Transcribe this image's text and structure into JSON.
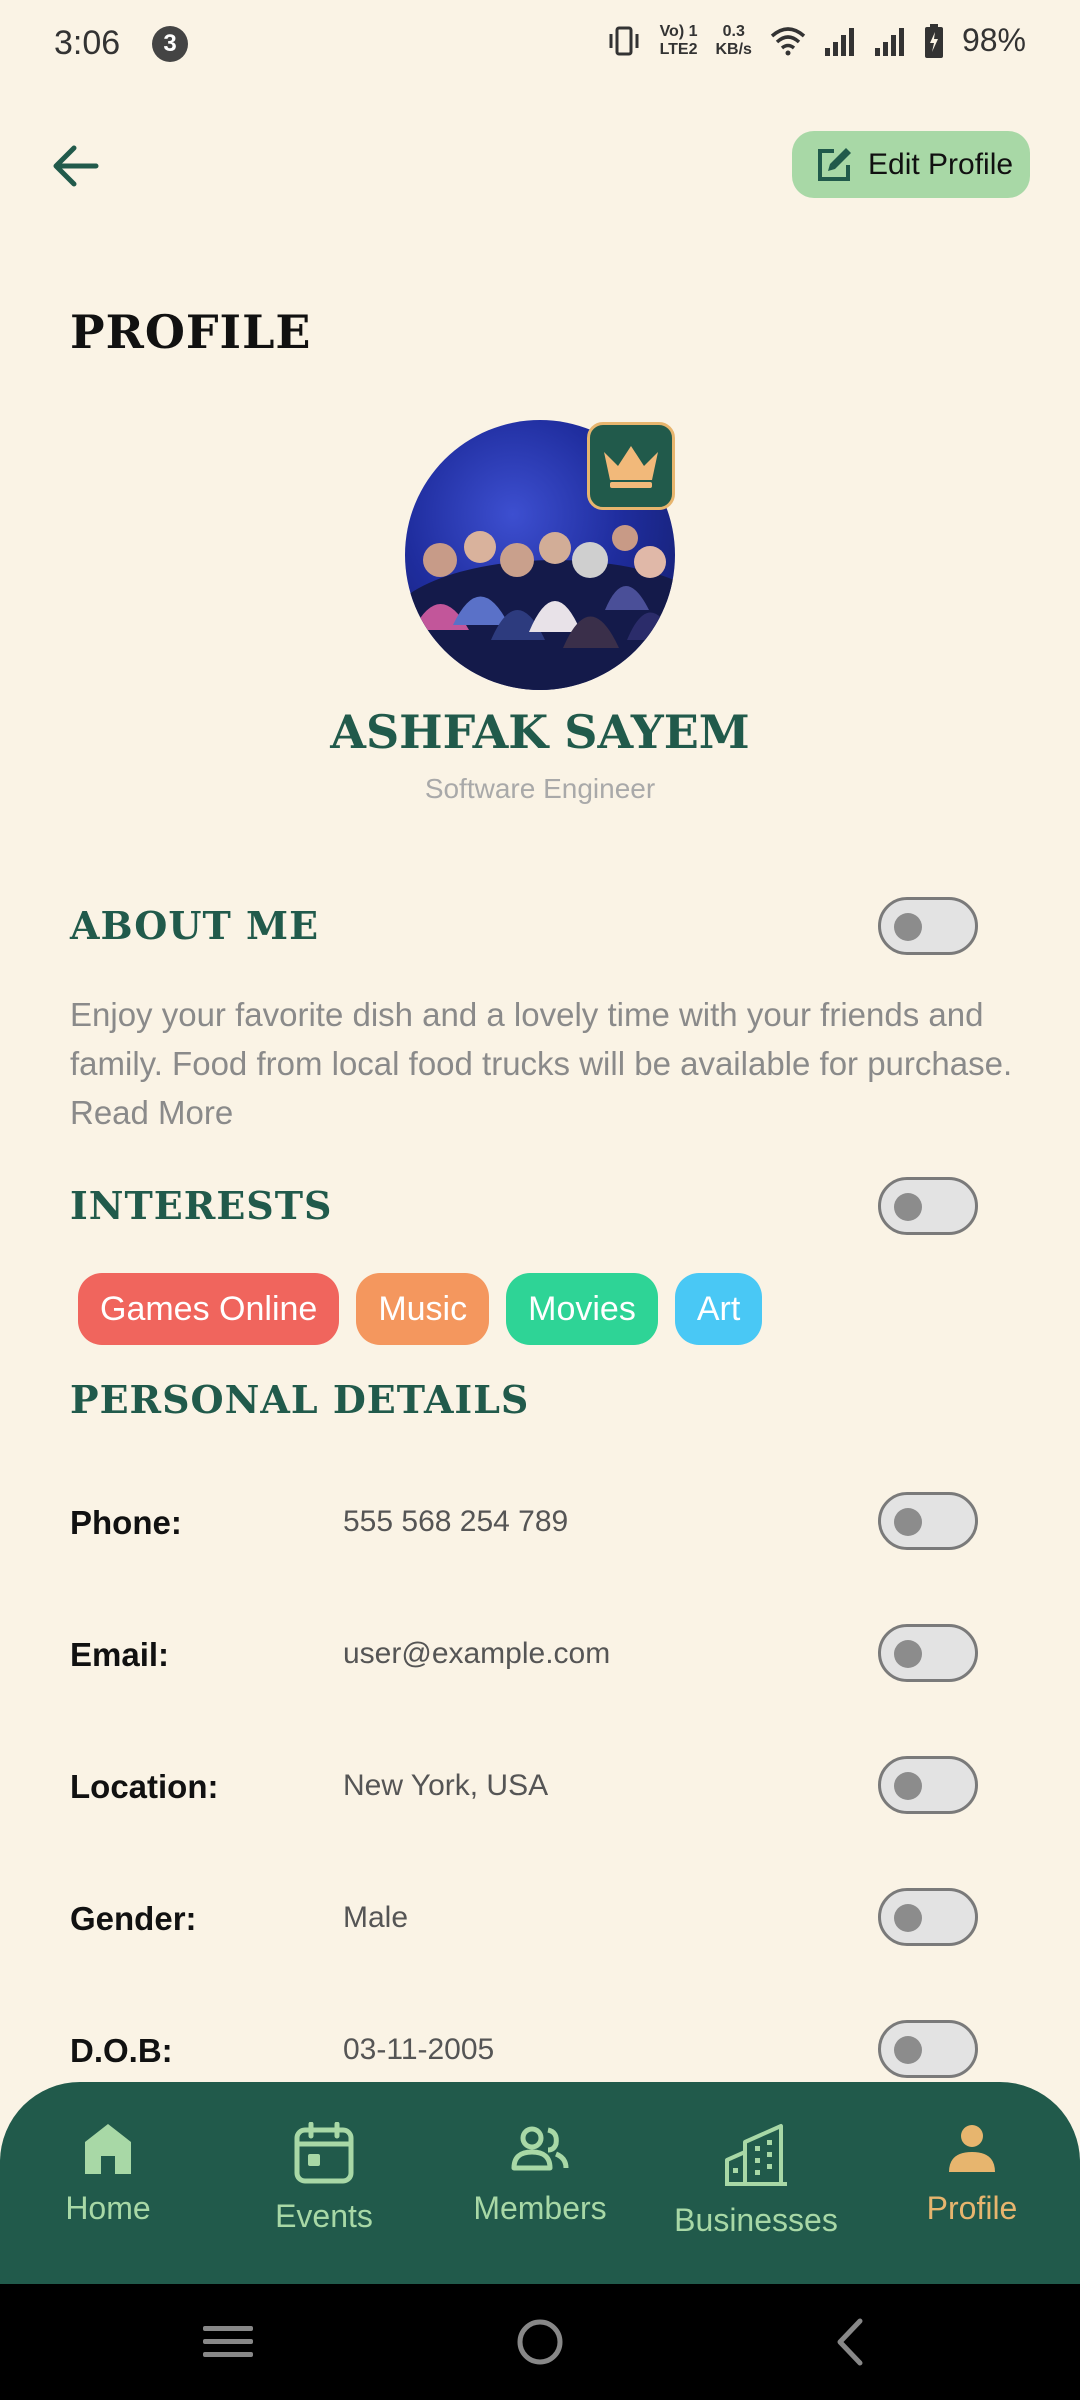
{
  "status_bar": {
    "time": "3:06",
    "notification_count": "3",
    "network_line1": "Vo) 1",
    "network_line2": "LTE2",
    "speed_line1": "0.3",
    "speed_line2": "KB/s",
    "battery": "98%"
  },
  "header": {
    "edit_label": "Edit Profile"
  },
  "page_title": "PROFILE",
  "user": {
    "name": "ASHFAK SAYEM",
    "role": "Software Engineer"
  },
  "about": {
    "heading": "ABOUT ME",
    "text": "Enjoy your favorite dish and a lovely time with your friends and family. Food from local food trucks will be available for purchase. Read More",
    "visible": false
  },
  "interests": {
    "heading": "INTERESTS",
    "visible": false,
    "items": [
      {
        "label": "Games Online",
        "color": "#f0655d"
      },
      {
        "label": "Music",
        "color": "#f4975e"
      },
      {
        "label": "Movies",
        "color": "#2ed496"
      },
      {
        "label": "Art",
        "color": "#49c8f5"
      }
    ]
  },
  "personal": {
    "heading": "PERSONAL DETAILS",
    "rows": [
      {
        "label": "Phone:",
        "value": "555 568 254 789",
        "visible": false
      },
      {
        "label": "Email:",
        "value": "user@example.com",
        "visible": false
      },
      {
        "label": "Location:",
        "value": "New York, USA",
        "visible": false
      },
      {
        "label": "Gender:",
        "value": "Male",
        "visible": false
      },
      {
        "label": "D.O.B:",
        "value": "03-11-2005",
        "visible": false
      }
    ]
  },
  "nav": {
    "items": [
      {
        "label": "Home",
        "icon": "home-icon"
      },
      {
        "label": "Events",
        "icon": "calendar-icon"
      },
      {
        "label": "Members",
        "icon": "members-icon"
      },
      {
        "label": "Businesses",
        "icon": "buildings-icon"
      },
      {
        "label": "Profile",
        "icon": "person-icon"
      }
    ],
    "active": "Profile"
  },
  "colors": {
    "background": "#faf3e5",
    "primary": "#215a4b",
    "accent": "#e7b56e",
    "edit_button": "#a8d8a6"
  }
}
